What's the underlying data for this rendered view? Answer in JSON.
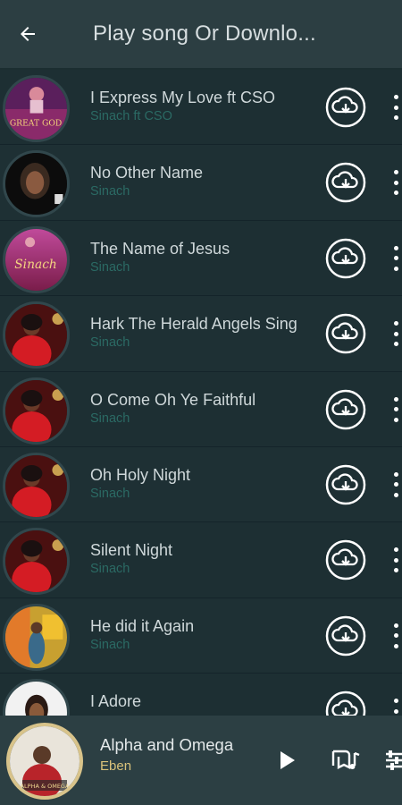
{
  "header": {
    "title": "Play song Or Downlo..."
  },
  "songs": [
    {
      "title": "I Express My Love ft CSO",
      "artist": "Sinach ft CSO",
      "art_text": "GREAT GOD"
    },
    {
      "title": "No Other Name",
      "artist": "Sinach"
    },
    {
      "title": "The Name of Jesus",
      "artist": "Sinach",
      "art_text": "Sinach"
    },
    {
      "title": "Hark The Herald Angels Sing",
      "artist": "Sinach"
    },
    {
      "title": "O Come Oh Ye Faithful",
      "artist": "Sinach"
    },
    {
      "title": "Oh Holy Night",
      "artist": "Sinach"
    },
    {
      "title": "Silent Night",
      "artist": "Sinach"
    },
    {
      "title": "He did it Again",
      "artist": "Sinach"
    },
    {
      "title": "I Adore",
      "artist": ""
    }
  ],
  "player": {
    "title": "Alpha and Omega",
    "artist": "Eben",
    "art_text": "ALPHA & OMEGA"
  },
  "colors": {
    "header_bg": "#2c3e42",
    "list_bg": "#1e3034",
    "artist_text": "#2b6a64",
    "player_artist": "#d9c27a"
  },
  "icons": {
    "back": "arrow-left-icon",
    "download": "cloud-download-icon",
    "more": "more-vertical-icon",
    "play": "play-icon",
    "queue": "queue-music-icon",
    "equalizer": "equalizer-icon"
  }
}
